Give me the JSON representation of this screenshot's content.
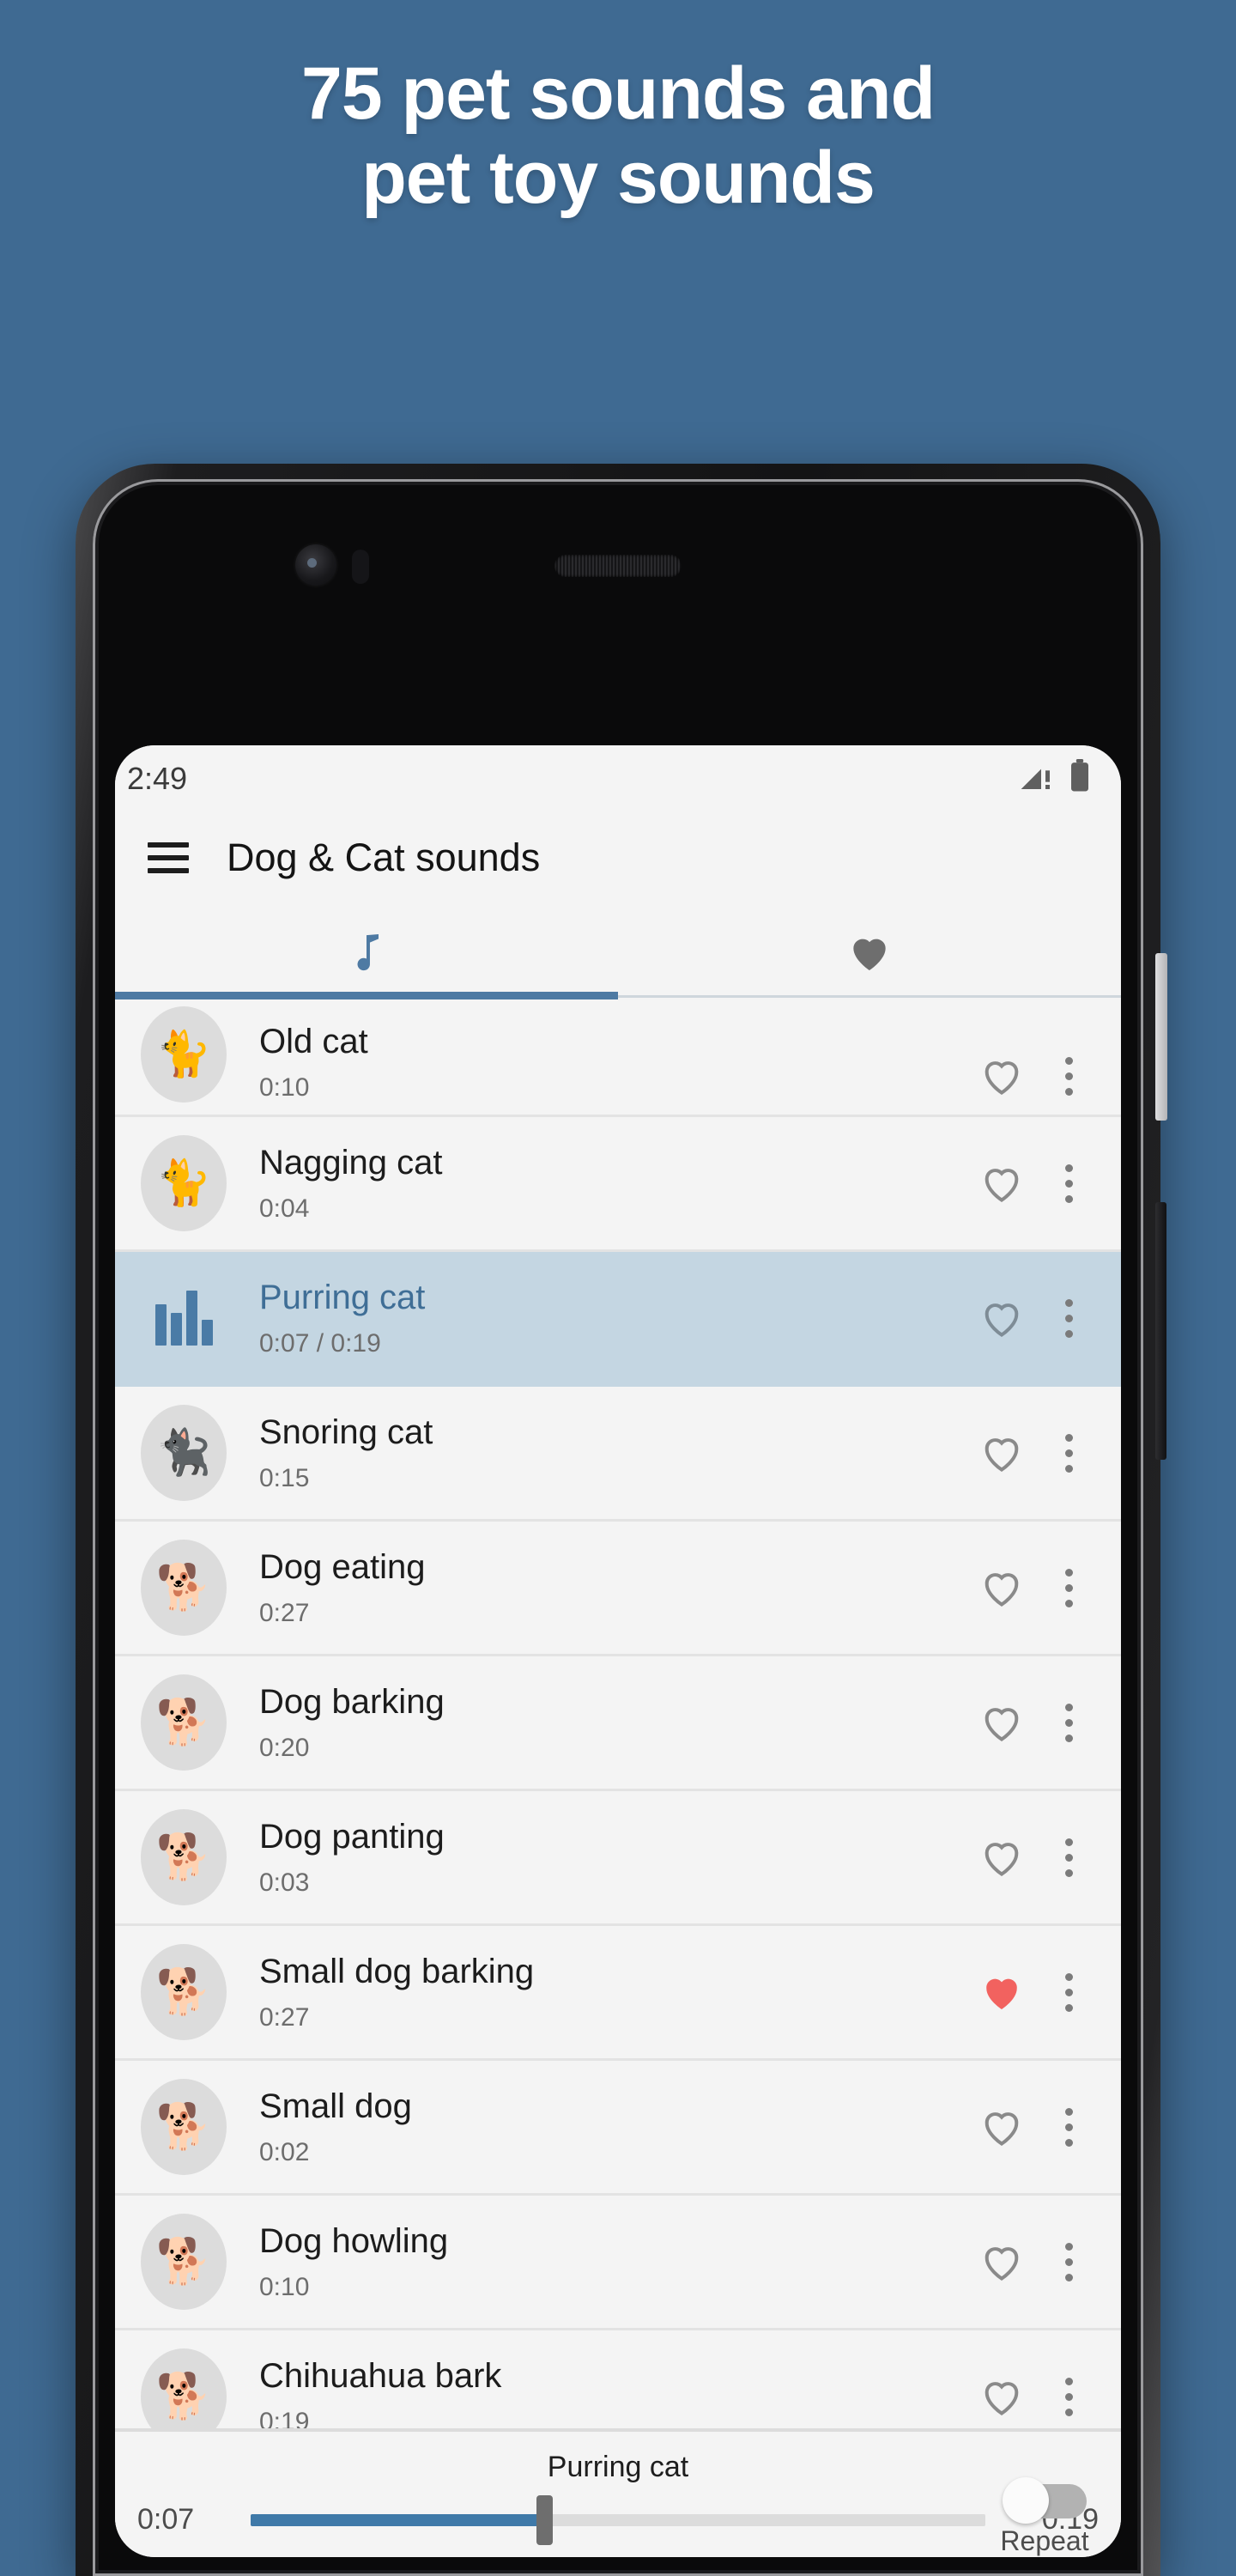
{
  "promo": {
    "line1": "75 pet sounds and",
    "line2": "pet toy sounds",
    "bg_color": "#3f6a92",
    "text_color": "#ffffff"
  },
  "phone": {
    "status_bar": {
      "time": "2:49",
      "signal_icon": "signal-warning-icon",
      "battery_icon": "battery-icon"
    }
  },
  "app": {
    "menu_icon": "hamburger-menu-icon",
    "title": "Dog & Cat sounds",
    "accent_color": "#4e7aa3",
    "tabs": [
      {
        "id": "sounds",
        "icon": "music-note-icon",
        "active": true
      },
      {
        "id": "favorites",
        "icon": "heart-icon",
        "active": false
      }
    ]
  },
  "list": {
    "items": [
      {
        "title": "Old cat",
        "duration": "0:10",
        "thumb": "🐈",
        "favorite": false,
        "playing": false
      },
      {
        "title": "Nagging cat",
        "duration": "0:04",
        "thumb": "🐈",
        "favorite": false,
        "playing": false
      },
      {
        "title": "Purring cat",
        "duration": "0:07 / 0:19",
        "thumb": "equalizer-icon",
        "favorite": false,
        "playing": true
      },
      {
        "title": "Snoring cat",
        "duration": "0:15",
        "thumb": "🐈‍⬛",
        "favorite": false,
        "playing": false
      },
      {
        "title": "Dog eating",
        "duration": "0:27",
        "thumb": "🐕",
        "favorite": false,
        "playing": false
      },
      {
        "title": "Dog barking",
        "duration": "0:20",
        "thumb": "🐕",
        "favorite": false,
        "playing": false
      },
      {
        "title": "Dog panting",
        "duration": "0:03",
        "thumb": "🐕",
        "favorite": false,
        "playing": false
      },
      {
        "title": "Small dog barking",
        "duration": "0:27",
        "thumb": "🐕",
        "favorite": true,
        "playing": false
      },
      {
        "title": "Small dog",
        "duration": "0:02",
        "thumb": "🐕",
        "favorite": false,
        "playing": false
      },
      {
        "title": "Dog howling",
        "duration": "0:10",
        "thumb": "🐕",
        "favorite": false,
        "playing": false
      },
      {
        "title": "Chihuahua bark",
        "duration": "0:19",
        "thumb": "🐕",
        "favorite": false,
        "playing": false
      }
    ],
    "favorite_on_color": "#f2625f",
    "favorite_off_color": "#8a8a8a",
    "selected_row_color": "#c4d6e2",
    "selected_title_color": "#3f6e96"
  },
  "player": {
    "track_title": "Purring cat",
    "elapsed": "0:07",
    "total": "0:19",
    "progress_percent": 40,
    "repeat_label": "Repeat",
    "repeat_on": false
  }
}
